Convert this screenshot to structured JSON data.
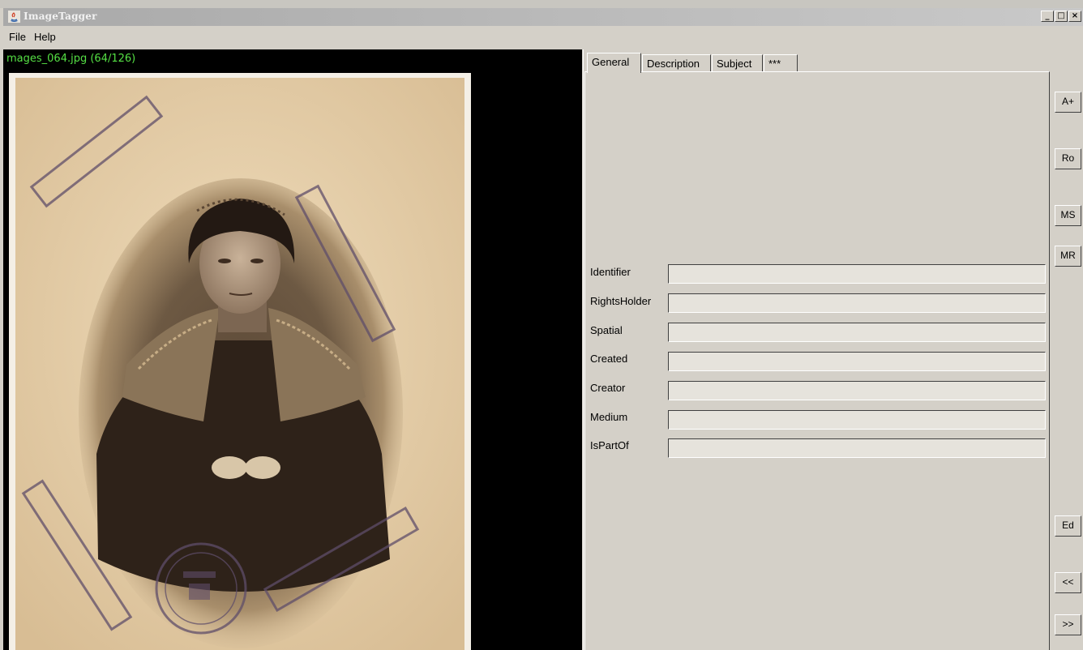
{
  "window": {
    "title": "ImageTagger",
    "minimize_glyph": "_",
    "maximize_glyph": "□",
    "close_glyph": "×"
  },
  "menu": {
    "items": [
      {
        "label": "File"
      },
      {
        "label": "Help"
      }
    ]
  },
  "viewer": {
    "file_label": "mages_064.jpg (64/126)",
    "background_color": "#000000",
    "label_color": "#55e044"
  },
  "tabs": [
    {
      "label": "General",
      "active": true
    },
    {
      "label": "Description",
      "active": false
    },
    {
      "label": "Subject",
      "active": false
    },
    {
      "label": "***",
      "active": false
    }
  ],
  "fields": [
    {
      "label": "Identifier",
      "value": ""
    },
    {
      "label": "RightsHolder",
      "value": ""
    },
    {
      "label": "Spatial",
      "value": ""
    },
    {
      "label": "Created",
      "value": ""
    },
    {
      "label": "Creator",
      "value": ""
    },
    {
      "label": "Medium",
      "value": ""
    },
    {
      "label": "IsPartOf",
      "value": ""
    }
  ],
  "side_buttons": {
    "a_plus": "A+",
    "ro": "Ro",
    "ms": "MS",
    "mr": "MR",
    "ed": "Ed",
    "prev": "<<",
    "next": ">>"
  }
}
